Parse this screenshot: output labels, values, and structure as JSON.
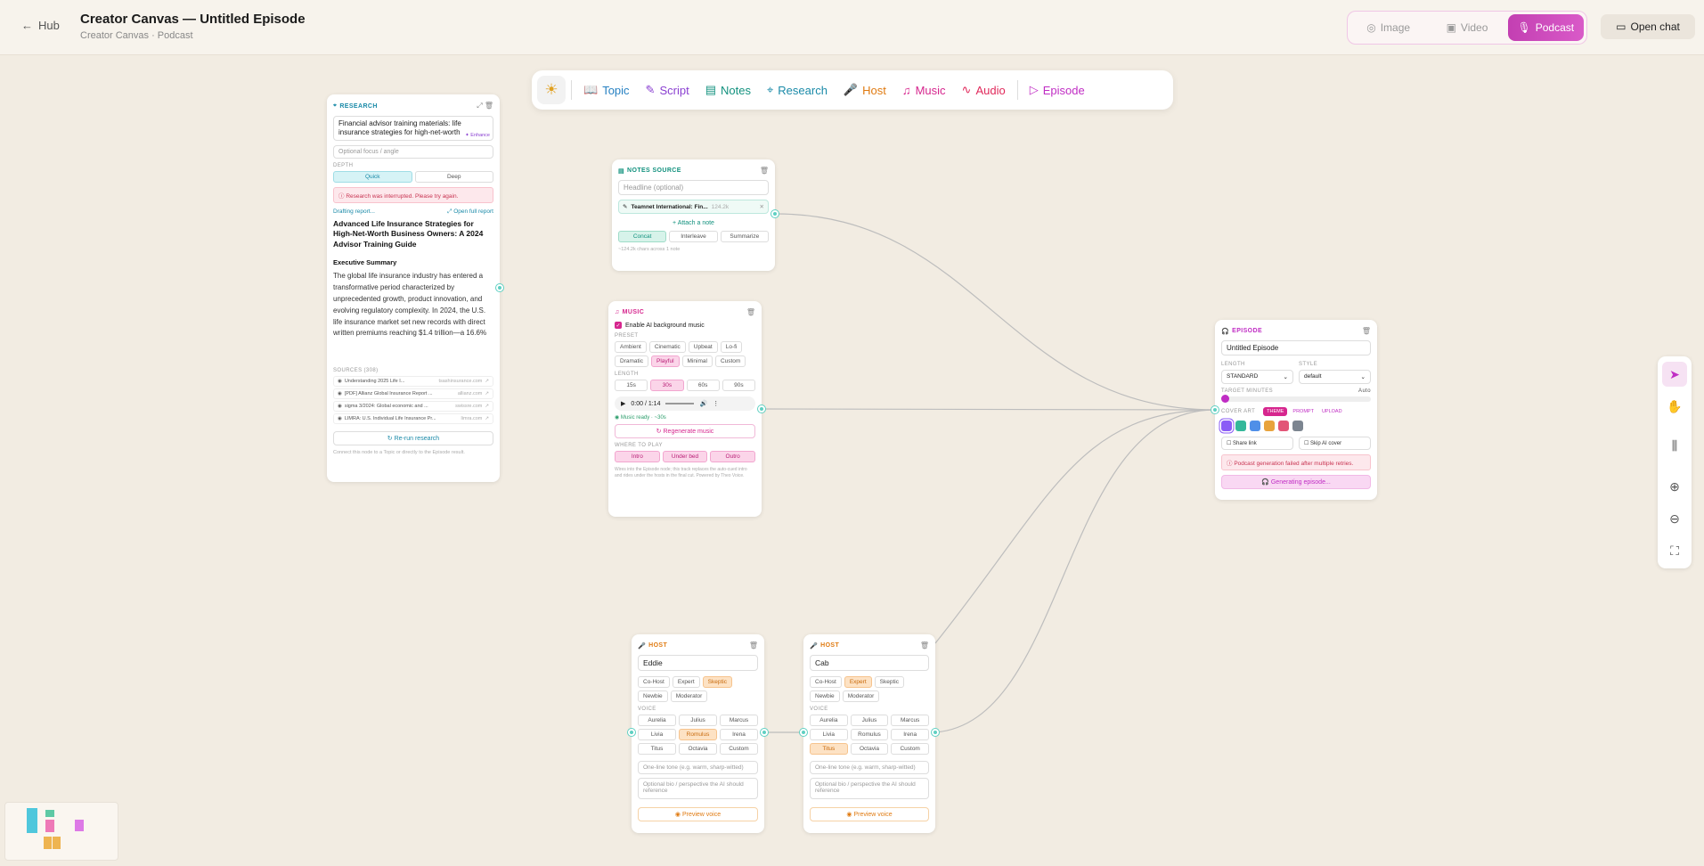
{
  "header": {
    "back_label": "Hub",
    "title": "Creator Canvas — Untitled Episode",
    "subtitle": "Creator Canvas · Podcast",
    "modes": [
      "Image",
      "Video",
      "Podcast"
    ],
    "open_chat": "Open chat"
  },
  "toolbar": {
    "items": [
      "Topic",
      "Script",
      "Notes",
      "Research",
      "Host",
      "Music",
      "Audio",
      "Episode"
    ]
  },
  "research": {
    "title": "RESEARCH",
    "topic": "Financial advisor training materials: life insurance strategies for high-net-worth",
    "enhance": "Enhance",
    "focus_placeholder": "Optional focus / angle",
    "depth_label": "DEPTH",
    "depth": [
      "Quick",
      "Deep"
    ],
    "error": "Research was interrupted. Please try again.",
    "drafting": "Drafting report...",
    "open_full": "Open full report",
    "report_title": "Advanced Life Insurance Strategies for High-Net-Worth Business Owners: A 2024 Advisor Training Guide",
    "section": "Executive Summary",
    "body": "The global life insurance industry has entered a transformative period characterized by unprecedented growth, product innovation, and evolving regulatory complexity. In 2024, the U.S. life insurance market set new records with direct written premiums reaching $1.4 trillion—a 16.6%",
    "sources_label": "SOURCES (308)",
    "sources": [
      {
        "t": "Understanding 2025 Life I...",
        "d": "tsashinsurance.com"
      },
      {
        "t": "[PDF] Allianz Global Insurance Report ...",
        "d": "allianz.com"
      },
      {
        "t": "sigma 3/2024: Global economic and ...",
        "d": "swissre.com"
      },
      {
        "t": "LIMRA: U.S. Individual Life Insurance Pr...",
        "d": "limra.com"
      }
    ],
    "rerun": "Re-run research",
    "footer": "Connect this node to a Topic or directly to the Episode result."
  },
  "notes": {
    "title": "NOTES SOURCE",
    "headline_placeholder": "Headline (optional)",
    "note_name": "Teamnet International: Fin...",
    "note_size": "124.2k",
    "attach": "Attach a note",
    "modes": [
      "Concat",
      "Interleave",
      "Summarize"
    ],
    "footer": "~124.2k chars across 1 note"
  },
  "music": {
    "title": "MUSIC",
    "enable_label": "Enable AI background music",
    "preset_label": "PRESET",
    "presets": [
      "Ambient",
      "Cinematic",
      "Upbeat",
      "Lo-fi",
      "Dramatic",
      "Playful",
      "Minimal",
      "Custom"
    ],
    "length_label": "LENGTH",
    "lengths": [
      "15s",
      "30s",
      "60s",
      "90s"
    ],
    "time": "0:00 / 1:14",
    "ready": "Music ready · ~30s",
    "regen": "Regenerate music",
    "where_label": "WHERE TO PLAY",
    "where": [
      "Intro",
      "Under bed",
      "Outro"
    ],
    "footer": "Wires into the Episode node; this track replaces the auto-cued intro and rides under the hosts in the final cut. Powered by Theo Voice."
  },
  "episode": {
    "title": "EPISODE",
    "name": "Untitled Episode",
    "length_label": "LENGTH",
    "length": "STANDARD",
    "style_label": "STYLE",
    "style": "default",
    "target_label": "TARGET MINUTES",
    "target_value": "Auto",
    "cover_label": "COVER ART",
    "cover_tabs": [
      "THEME",
      "PROMPT",
      "UPLOAD"
    ],
    "swatches": [
      "#8b5cf6",
      "#34b89a",
      "#4f8fe8",
      "#e8a33c",
      "#e25577",
      "#7c8590"
    ],
    "share": "Share link",
    "skip": "Skip AI cover",
    "error": "Podcast generation failed after multiple retries.",
    "generating": "Generating episode..."
  },
  "hosts": [
    {
      "title": "HOST",
      "name": "Eddie",
      "roles": [
        "Co-Host",
        "Expert",
        "Skeptic",
        "Newbie",
        "Moderator"
      ],
      "active_role": "Skeptic",
      "voice_label": "VOICE",
      "voices": [
        "Aurelia",
        "Julius",
        "Marcus",
        "Livia",
        "Romulus",
        "Irena",
        "Titus",
        "Octavia",
        "Custom"
      ],
      "active_voice": "Romulus",
      "tone_placeholder": "One-line tone (e.g. warm, sharp-witted)",
      "bio_placeholder": "Optional bio / perspective the AI should reference",
      "preview": "Preview voice"
    },
    {
      "title": "HOST",
      "name": "Cab",
      "roles": [
        "Co-Host",
        "Expert",
        "Skeptic",
        "Newbie",
        "Moderator"
      ],
      "active_role": "Expert",
      "voice_label": "VOICE",
      "voices": [
        "Aurelia",
        "Julius",
        "Marcus",
        "Livia",
        "Romulus",
        "Irena",
        "Titus",
        "Octavia",
        "Custom"
      ],
      "active_voice": "Titus",
      "tone_placeholder": "One-line tone (e.g. warm, sharp-witted)",
      "bio_placeholder": "Optional bio / perspective the AI should reference",
      "preview": "Preview voice"
    }
  ],
  "colors": {
    "topic": "#2680c2",
    "script": "#8a3fd1",
    "notes": "#12917e",
    "research": "#1a8aa8",
    "host": "#e07b12",
    "music": "#d6268e",
    "audio": "#e0285a",
    "episode": "#c02dc4"
  }
}
